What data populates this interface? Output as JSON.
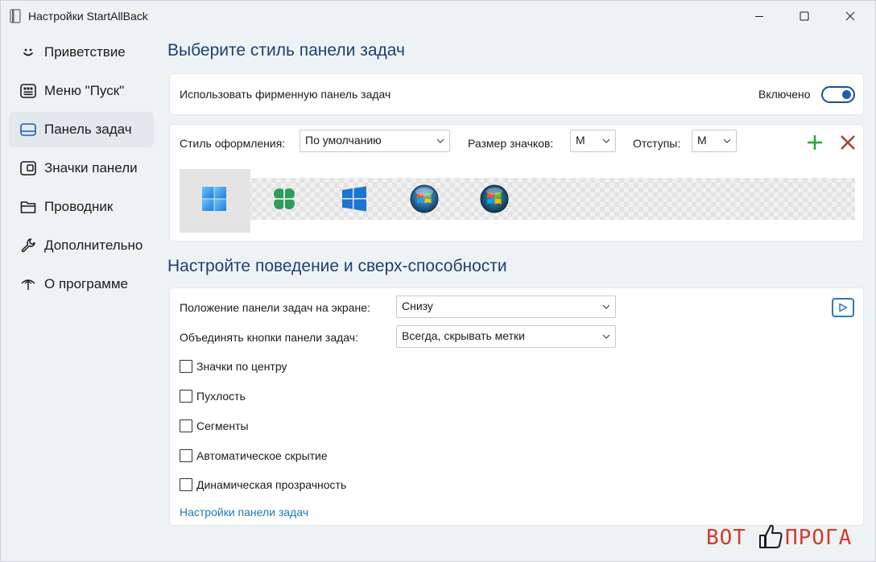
{
  "window": {
    "title": "Настройки StartAllBack",
    "controls": {
      "minimize": "minimize-icon",
      "maximize": "maximize-icon",
      "close": "close-icon"
    }
  },
  "sidebar": {
    "items": [
      {
        "label": "Приветствие",
        "icon": "smile-icon",
        "active": false
      },
      {
        "label": "Меню \"Пуск\"",
        "icon": "start-menu-icon",
        "active": false
      },
      {
        "label": "Панель задач",
        "icon": "taskbar-icon",
        "active": true
      },
      {
        "label": "Значки панели",
        "icon": "tray-icon",
        "active": false
      },
      {
        "label": "Проводник",
        "icon": "folder-icon",
        "active": false
      },
      {
        "label": "Дополнительно",
        "icon": "wrench-icon",
        "active": false
      },
      {
        "label": "О программе",
        "icon": "about-icon",
        "active": false
      }
    ]
  },
  "taskbar_style": {
    "section_title": "Выберите стиль панели задач",
    "toggle_label": "Использовать фирменную панель задач",
    "toggle_state": "Включено",
    "toggle_on": true,
    "theme_label": "Стиль оформления:",
    "theme_value": "По умолчанию",
    "icon_size_label": "Размер значков:",
    "icon_size_value": "M",
    "padding_label": "Отступы:",
    "padding_value": "M",
    "styles": [
      "windows-11-icon",
      "clover-icon",
      "windows-10-icon",
      "windows-vista-orb-icon",
      "windows-7-orb-icon"
    ],
    "selected_style": 0
  },
  "behavior": {
    "section_title": "Настройте поведение и сверх-способности",
    "position_label": "Положение панели задач на экране:",
    "position_value": "Снизу",
    "combine_label": "Объединять кнопки панели задач:",
    "combine_value": "Всегда, скрывать метки",
    "checkboxes": [
      {
        "label": "Значки по центру",
        "checked": false
      },
      {
        "label": "Пухлость",
        "checked": false
      },
      {
        "label": "Сегменты",
        "checked": false
      },
      {
        "label": "Автоматическое скрытие",
        "checked": false
      },
      {
        "label": "Динамическая прозрачность",
        "checked": false
      }
    ],
    "link": "Настройки панели задач"
  },
  "watermark": {
    "left": "ВОТ",
    "right": "ПРОГА"
  },
  "colors": {
    "accent": "#1b5fb4",
    "title": "#1e3f73",
    "link": "#1e7ab8",
    "add": "#2aa838",
    "delete": "#b03a2e"
  }
}
